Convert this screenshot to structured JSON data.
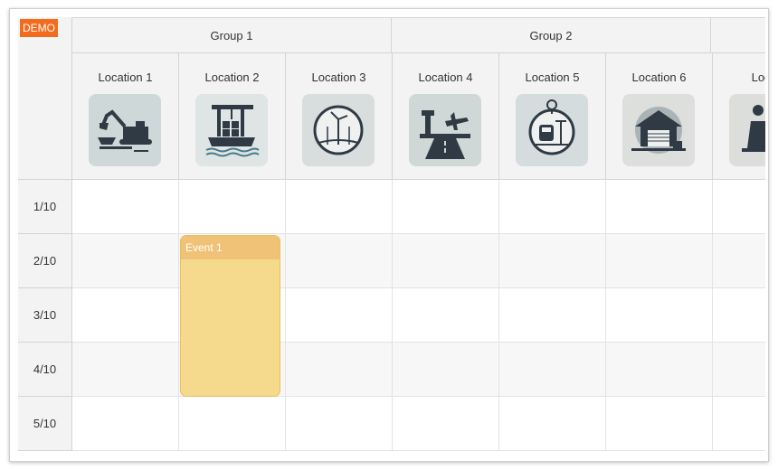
{
  "demo_badge": "DEMO",
  "groups": [
    {
      "label": "Group 1"
    },
    {
      "label": "Group 2"
    },
    {
      "label": ""
    }
  ],
  "locations": [
    {
      "label": "Location 1",
      "icon": "excavator-icon"
    },
    {
      "label": "Location 2",
      "icon": "port-crane-icon"
    },
    {
      "label": "Location 3",
      "icon": "wind-turbine-icon"
    },
    {
      "label": "Location 4",
      "icon": "airport-icon"
    },
    {
      "label": "Location 5",
      "icon": "train-station-icon"
    },
    {
      "label": "Location 6",
      "icon": "warehouse-icon"
    },
    {
      "label": "Locat",
      "icon": "power-plant-icon"
    }
  ],
  "rows": [
    {
      "label": "1/10"
    },
    {
      "label": "2/10"
    },
    {
      "label": "3/10"
    },
    {
      "label": "4/10"
    },
    {
      "label": "5/10"
    }
  ],
  "events": [
    {
      "text": "Event 1",
      "location": "Location 2",
      "start": "2/10",
      "end": "4/10"
    }
  ],
  "colors": {
    "header_bg": "#f3f3f3",
    "demo_badge": "#f36b1c",
    "event_bg": "#f5d98c",
    "event_bar": "#f0c278"
  }
}
